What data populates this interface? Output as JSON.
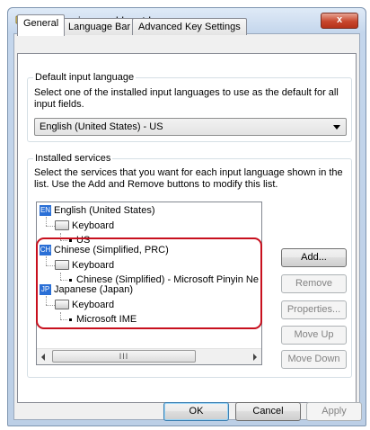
{
  "window": {
    "title": "Text Services and Input Languages",
    "close_glyph": "x"
  },
  "tabs": [
    {
      "label": "General"
    },
    {
      "label": "Language Bar"
    },
    {
      "label": "Advanced Key Settings"
    }
  ],
  "default_input": {
    "legend": "Default input language",
    "description": "Select one of the installed input languages to use as the default for all input fields.",
    "selected": "English (United States) - US"
  },
  "installed": {
    "legend": "Installed services",
    "description": "Select the services that you want for each input language shown in the list. Use the Add and Remove buttons to modify this list.",
    "tree": [
      {
        "badge": "EN",
        "language": "English (United States)",
        "keyboard": "Keyboard",
        "service": "US"
      },
      {
        "badge": "CH",
        "language": "Chinese (Simplified, PRC)",
        "keyboard": "Keyboard",
        "service": "Chinese (Simplified) - Microsoft Pinyin Ne"
      },
      {
        "badge": "JP",
        "language": "Japanese (Japan)",
        "keyboard": "Keyboard",
        "service": "Microsoft IME"
      }
    ],
    "scroll_thumb": "III"
  },
  "side_buttons": {
    "add": "Add...",
    "remove": "Remove",
    "properties": "Properties...",
    "move_up": "Move Up",
    "move_down": "Move Down"
  },
  "footer": {
    "ok": "OK",
    "cancel": "Cancel",
    "apply": "Apply"
  },
  "colors": {
    "highlight": "#c8101e",
    "badge": "#2a6fd6"
  }
}
